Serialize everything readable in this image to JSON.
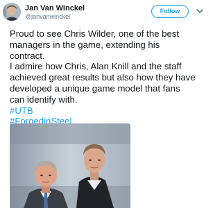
{
  "author": {
    "display_name": "Jan Van Winckel",
    "handle": "@janvanwinckel"
  },
  "actions": {
    "follow_label": "Follow",
    "more_icon": "chevron-down-icon"
  },
  "tweet": {
    "text_lines": [
      "Proud to see Chris Wilder, one of the best",
      "managers in the game, extending his",
      "contract.",
      "I admire how Chris, Alan Knill and the staff",
      "achieved great results but also how they have",
      "developed a unique game model that fans",
      "can identify with."
    ],
    "hashtags": [
      "#UTB",
      "#ForgedinSteel"
    ]
  },
  "colors": {
    "link": "#1da1f2",
    "text": "#14171a",
    "muted": "#657786"
  }
}
